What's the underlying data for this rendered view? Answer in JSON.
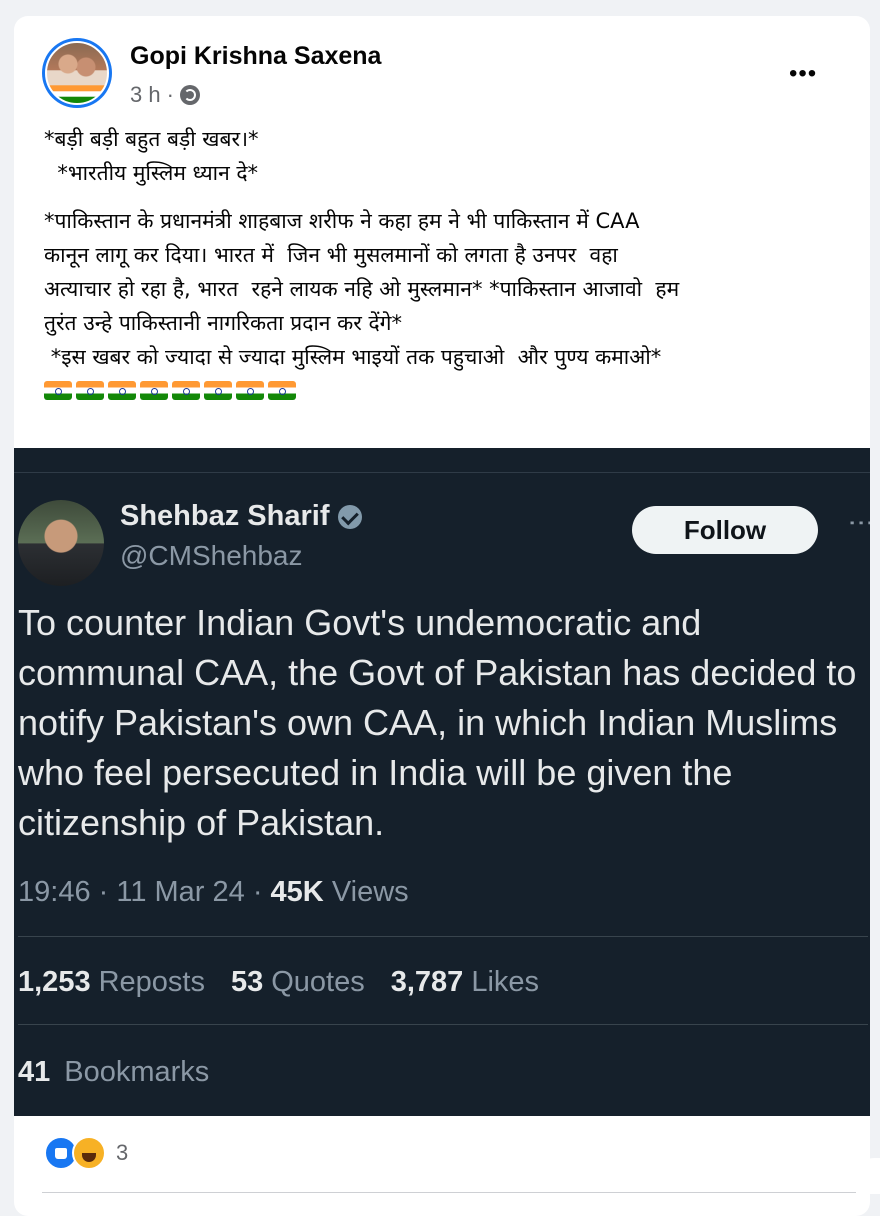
{
  "post": {
    "author": "Gopi Krishna Saxena",
    "time": "3 h",
    "separator": "·",
    "more_label": "•••",
    "text_lines": [
      "*बड़ी बड़ी बहुत बड़ी खबर।*",
      "  *भारतीय मुस्लिम ध्यान दे*",
      "*पाकिस्तान के प्रधानमंत्री शाहबाज शरीफ ने कहा हम ने भी पाकिस्तान में CAA",
      "कानून लागू कर दिया। भारत में  जिन भी मुसलमानों को लगता है उनपर  वहा",
      "अत्याचार हो रहा है, भारत  रहने लायक नहि ओ मुस्लमान* *पाकिस्तान आजावो  हम",
      "तुरंत उन्हे पाकिस्तानी नागरिकता प्रदान कर देंगे*",
      " *इस खबर को ज्यादा से ज्यादा मुस्लिम भाइयों तक पहुचाओ  और पुण्य कमाओ*"
    ],
    "flags_count": 8,
    "reaction_count": "3"
  },
  "tweet": {
    "name": "Shehbaz Sharif",
    "handle": "@CMShehbaz",
    "follow_label": "Follow",
    "more_label": "⋮",
    "text": "To counter Indian Govt's undemocratic and communal CAA, the Govt of Pakistan has decided to notify Pakistan's own CAA, in which Indian Muslims who feel persecuted in India will be given the citizenship of Pakistan.",
    "time": "19:46 · 11 Mar 24 · ",
    "views_count": "45K",
    "views_label": "Views",
    "reposts_count": "1,253",
    "reposts_label": "Reposts",
    "quotes_count": "53",
    "quotes_label": "Quotes",
    "likes_count": "3,787",
    "likes_label": "Likes",
    "bookmarks_count": "41",
    "bookmarks_label": "Bookmarks"
  },
  "colors": {
    "tweet_bg": "#15202b",
    "facebook_blue": "#1877f2"
  }
}
